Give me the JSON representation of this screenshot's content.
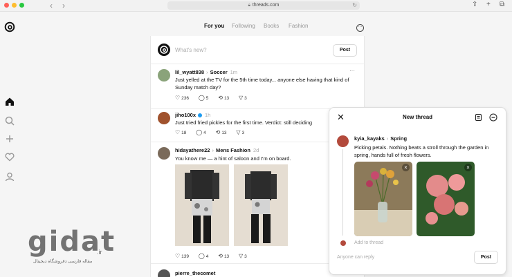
{
  "browser": {
    "url": "threads.com",
    "traffic_lights": [
      "#ff5f57",
      "#febc2e",
      "#28c840"
    ]
  },
  "sidebar": {
    "items": [
      {
        "icon": "home-icon"
      },
      {
        "icon": "search-icon"
      },
      {
        "icon": "plus-icon"
      },
      {
        "icon": "heart-icon"
      },
      {
        "icon": "profile-icon"
      }
    ]
  },
  "feed_tabs": [
    "For you",
    "Following",
    "Books",
    "Fashion"
  ],
  "composer": {
    "placeholder": "What's new?",
    "post_label": "Post"
  },
  "posts": [
    {
      "username": "lil_wyatt838",
      "topic": "Soccer",
      "time": "1m",
      "text": "Just yelled at the TV for the 5th time today... anyone else having that kind of Sunday match day?",
      "likes": "236",
      "replies": "5",
      "reposts": "13",
      "shares": "3"
    },
    {
      "username": "jiho100x",
      "topic": "",
      "time": "1h",
      "verified": true,
      "text": "Just tried fried pickles for the first time. Verdict: still deciding",
      "likes": "18",
      "replies": "4",
      "reposts": "13",
      "shares": "3"
    },
    {
      "username": "hidayathere22",
      "topic": "Mens Fashion",
      "time": "2d",
      "text": "You know me — a hint of saloon and I'm on board.",
      "likes": "139",
      "replies": "4",
      "reposts": "13",
      "shares": "3"
    },
    {
      "username": "pierre_thecomet",
      "topic": "",
      "time": "",
      "text": ""
    }
  ],
  "modal": {
    "title": "New thread",
    "username": "kyia_kayaks",
    "topic": "Spring",
    "text": "Picking petals. Nothing beats a stroll through the garden in spring, hands full of fresh flowers.",
    "add_to_thread": "Add to thread",
    "reply_setting": "Anyone can reply",
    "post_label": "Post"
  },
  "watermark": {
    "brand": "gidat",
    "tld": ".ir",
    "tagline": "مقاله فارسی دفروشگاه دیجیتال"
  }
}
